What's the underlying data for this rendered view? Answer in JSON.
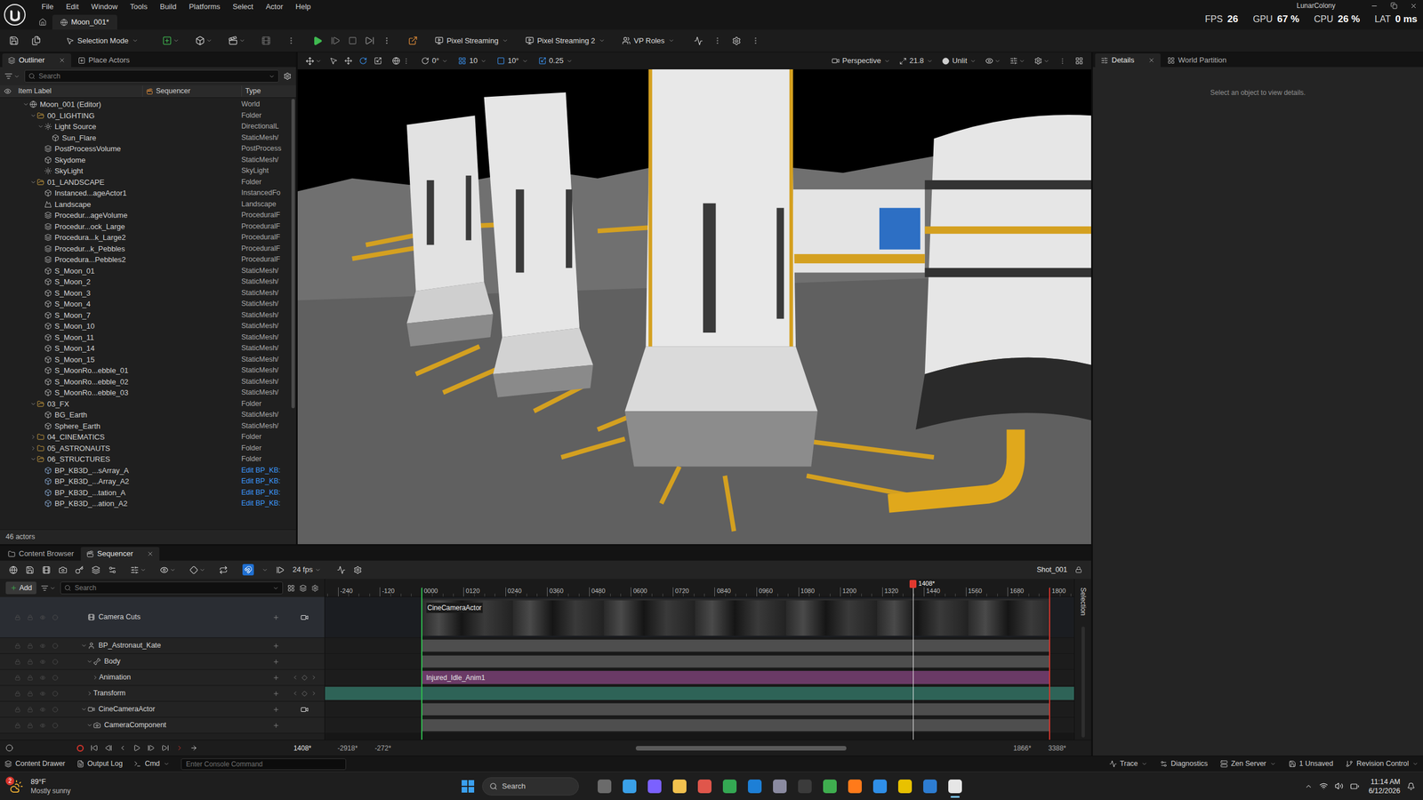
{
  "header": {
    "project": "LunarColony",
    "level_tab": "Moon_001*",
    "menu": [
      "File",
      "Edit",
      "Window",
      "Tools",
      "Build",
      "Platforms",
      "Select",
      "Actor",
      "Help"
    ],
    "stats": [
      {
        "label": "FPS",
        "value": "26"
      },
      {
        "label": "GPU",
        "value": "67 %"
      },
      {
        "label": "CPU",
        "value": "26 %"
      },
      {
        "label": "LAT",
        "value": "0 ms"
      }
    ]
  },
  "toolbar": {
    "mode": "Selection Mode",
    "streaming": [
      "Pixel Streaming",
      "Pixel Streaming 2",
      "VP Roles"
    ]
  },
  "outliner": {
    "tabs": [
      {
        "label": "Outliner",
        "selected": true,
        "closable": true
      },
      {
        "label": "Place Actors",
        "selected": false,
        "closable": false
      }
    ],
    "search_placeholder": "Search",
    "columns": [
      "Item Label",
      "Sequencer",
      "Type"
    ],
    "footer": "46 actors",
    "rows": [
      {
        "label": "Moon_001 (Editor)",
        "type": "World",
        "depth": 0,
        "kind": "world",
        "has_children": true,
        "expanded": true,
        "type_link": false
      },
      {
        "label": "00_LIGHTING",
        "type": "Folder",
        "depth": 1,
        "kind": "folder",
        "has_children": true,
        "expanded": true,
        "type_link": false
      },
      {
        "label": "Light Source",
        "type": "DirectionalL",
        "depth": 2,
        "kind": "light",
        "has_children": true,
        "expanded": true,
        "type_link": false
      },
      {
        "label": "Sun_Flare",
        "type": "StaticMesh/",
        "depth": 3,
        "kind": "mesh",
        "has_children": false,
        "expanded": false,
        "type_link": false
      },
      {
        "label": "PostProcessVolume",
        "type": "PostProcess",
        "depth": 2,
        "kind": "volume",
        "has_children": false,
        "expanded": false,
        "type_link": false
      },
      {
        "label": "Skydome",
        "type": "StaticMesh/",
        "depth": 2,
        "kind": "mesh",
        "has_children": false,
        "expanded": false,
        "type_link": false
      },
      {
        "label": "SkyLight",
        "type": "SkyLight",
        "depth": 2,
        "kind": "light",
        "has_children": false,
        "expanded": false,
        "type_link": false
      },
      {
        "label": "01_LANDSCAPE",
        "type": "Folder",
        "depth": 1,
        "kind": "folder",
        "has_children": true,
        "expanded": true,
        "type_link": false
      },
      {
        "label": "Instanced...ageActor1",
        "type": "InstancedFo",
        "depth": 2,
        "kind": "mesh",
        "has_children": false,
        "expanded": false,
        "type_link": false
      },
      {
        "label": "Landscape",
        "type": "Landscape",
        "depth": 2,
        "kind": "landscape",
        "has_children": false,
        "expanded": false,
        "type_link": false
      },
      {
        "label": "Procedur...ageVolume",
        "type": "ProceduralF",
        "depth": 2,
        "kind": "volume",
        "has_children": false,
        "expanded": false,
        "type_link": false
      },
      {
        "label": "Procedur...ock_Large",
        "type": "ProceduralF",
        "depth": 2,
        "kind": "volume",
        "has_children": false,
        "expanded": false,
        "type_link": false
      },
      {
        "label": "Procedura...k_Large2",
        "type": "ProceduralF",
        "depth": 2,
        "kind": "volume",
        "has_children": false,
        "expanded": false,
        "type_link": false
      },
      {
        "label": "Procedur...k_Pebbles",
        "type": "ProceduralF",
        "depth": 2,
        "kind": "volume",
        "has_children": false,
        "expanded": false,
        "type_link": false
      },
      {
        "label": "Procedura...Pebbles2",
        "type": "ProceduralF",
        "depth": 2,
        "kind": "volume",
        "has_children": false,
        "expanded": false,
        "type_link": false
      },
      {
        "label": "S_Moon_01",
        "type": "StaticMesh/",
        "depth": 2,
        "kind": "mesh",
        "has_children": false,
        "expanded": false,
        "type_link": false
      },
      {
        "label": "S_Moon_2",
        "type": "StaticMesh/",
        "depth": 2,
        "kind": "mesh",
        "has_children": false,
        "expanded": false,
        "type_link": false
      },
      {
        "label": "S_Moon_3",
        "type": "StaticMesh/",
        "depth": 2,
        "kind": "mesh",
        "has_children": false,
        "expanded": false,
        "type_link": false
      },
      {
        "label": "S_Moon_4",
        "type": "StaticMesh/",
        "depth": 2,
        "kind": "mesh",
        "has_children": false,
        "expanded": false,
        "type_link": false
      },
      {
        "label": "S_Moon_7",
        "type": "StaticMesh/",
        "depth": 2,
        "kind": "mesh",
        "has_children": false,
        "expanded": false,
        "type_link": false
      },
      {
        "label": "S_Moon_10",
        "type": "StaticMesh/",
        "depth": 2,
        "kind": "mesh",
        "has_children": false,
        "expanded": false,
        "type_link": false
      },
      {
        "label": "S_Moon_11",
        "type": "StaticMesh/",
        "depth": 2,
        "kind": "mesh",
        "has_children": false,
        "expanded": false,
        "type_link": false
      },
      {
        "label": "S_Moon_14",
        "type": "StaticMesh/",
        "depth": 2,
        "kind": "mesh",
        "has_children": false,
        "expanded": false,
        "type_link": false
      },
      {
        "label": "S_Moon_15",
        "type": "StaticMesh/",
        "depth": 2,
        "kind": "mesh",
        "has_children": false,
        "expanded": false,
        "type_link": false
      },
      {
        "label": "S_MoonRo...ebble_01",
        "type": "StaticMesh/",
        "depth": 2,
        "kind": "mesh",
        "has_children": false,
        "expanded": false,
        "type_link": false
      },
      {
        "label": "S_MoonRo...ebble_02",
        "type": "StaticMesh/",
        "depth": 2,
        "kind": "mesh",
        "has_children": false,
        "expanded": false,
        "type_link": false
      },
      {
        "label": "S_MoonRo...ebble_03",
        "type": "StaticMesh/",
        "depth": 2,
        "kind": "mesh",
        "has_children": false,
        "expanded": false,
        "type_link": false
      },
      {
        "label": "03_FX",
        "type": "Folder",
        "depth": 1,
        "kind": "folder",
        "has_children": true,
        "expanded": true,
        "type_link": false
      },
      {
        "label": "BG_Earth",
        "type": "StaticMesh/",
        "depth": 2,
        "kind": "mesh",
        "has_children": false,
        "expanded": false,
        "type_link": false
      },
      {
        "label": "Sphere_Earth",
        "type": "StaticMesh/",
        "depth": 2,
        "kind": "mesh",
        "has_children": false,
        "expanded": false,
        "type_link": false
      },
      {
        "label": "04_CINEMATICS",
        "type": "Folder",
        "depth": 1,
        "kind": "folder",
        "has_children": true,
        "expanded": false,
        "type_link": false
      },
      {
        "label": "05_ASTRONAUTS",
        "type": "Folder",
        "depth": 1,
        "kind": "folder",
        "has_children": true,
        "expanded": false,
        "type_link": false
      },
      {
        "label": "06_STRUCTURES",
        "type": "Folder",
        "depth": 1,
        "kind": "folder",
        "has_children": true,
        "expanded": true,
        "type_link": false
      },
      {
        "label": "BP_KB3D_...sArray_A",
        "type": "Edit BP_KB:",
        "depth": 2,
        "kind": "blueprint",
        "has_children": false,
        "expanded": false,
        "type_link": true
      },
      {
        "label": "BP_KB3D_...Array_A2",
        "type": "Edit BP_KB:",
        "depth": 2,
        "kind": "blueprint",
        "has_children": false,
        "expanded": false,
        "type_link": true
      },
      {
        "label": "BP_KB3D_...tation_A",
        "type": "Edit BP_KB:",
        "depth": 2,
        "kind": "blueprint",
        "has_children": false,
        "expanded": false,
        "type_link": true
      },
      {
        "label": "BP_KB3D_...ation_A2",
        "type": "Edit BP_KB:",
        "depth": 2,
        "kind": "blueprint",
        "has_children": false,
        "expanded": false,
        "type_link": true
      }
    ]
  },
  "viewport": {
    "tools": [
      {
        "kind": "select",
        "selected": false
      },
      {
        "kind": "move",
        "selected": false
      },
      {
        "kind": "rotate",
        "selected": true
      },
      {
        "kind": "scale",
        "selected": false
      }
    ],
    "snaps": [
      {
        "value": "0°",
        "active": false
      },
      {
        "value": "10",
        "active": true
      },
      {
        "value": "10°",
        "active": true
      },
      {
        "value": "0.25",
        "active": true
      }
    ],
    "perspective": "Perspective",
    "fov": "21.8",
    "lighting": "Unlit"
  },
  "details": {
    "tabs": [
      {
        "label": "Details",
        "selected": true,
        "closable": true
      },
      {
        "label": "World Partition",
        "selected": false,
        "closable": false
      }
    ],
    "empty_message": "Select an object to view details."
  },
  "sequencer": {
    "tabs": [
      {
        "label": "Content Browser",
        "selected": false,
        "closable": false
      },
      {
        "label": "Sequencer",
        "selected": true,
        "closable": true
      }
    ],
    "fps": "24 fps",
    "shot": "Shot_001",
    "snap_enabled": true,
    "add_label": "Add",
    "search_placeholder": "Search",
    "ticks": [
      "-240",
      "-120",
      "0000",
      "0120",
      "0240",
      "0360",
      "0480",
      "0600",
      "0720",
      "0840",
      "0960",
      "1080",
      "1200",
      "1320",
      "1440",
      "1560",
      "1680",
      "1800"
    ],
    "range_start": 0,
    "range_end": 1800,
    "playhead": "1408*",
    "side_label": "Selection",
    "tracks": [
      {
        "label": "Camera Cuts",
        "depth": 0,
        "kind": "camera-cuts",
        "has_children": false,
        "expanded": false,
        "lane": "thumbnails",
        "clip_label": "CineCameraActor",
        "color": "#2b2b2b"
      },
      {
        "label": "BP_Astronaut_Kate",
        "depth": 0,
        "kind": "actor",
        "has_children": true,
        "expanded": true,
        "lane": "range",
        "color": "#4e4e4e"
      },
      {
        "label": "Body",
        "depth": 1,
        "kind": "component",
        "has_children": true,
        "expanded": true,
        "lane": "range",
        "color": "#4e4e4e"
      },
      {
        "label": "Animation",
        "depth": 2,
        "kind": "animation",
        "has_children": true,
        "expanded": false,
        "lane": "clip",
        "clip_label": "Injured_Idle_Anim1",
        "color": "#6a3a66"
      },
      {
        "label": "Transform",
        "depth": 1,
        "kind": "transform",
        "has_children": true,
        "expanded": false,
        "lane": "full",
        "color": "#2e6357"
      },
      {
        "label": "CineCameraActor",
        "depth": 0,
        "kind": "camera",
        "has_children": true,
        "expanded": true,
        "lane": "range",
        "color": "#4e4e4e"
      },
      {
        "label": "CameraComponent",
        "depth": 1,
        "kind": "camera-component",
        "has_children": true,
        "expanded": true,
        "lane": "range",
        "color": "#4e4e4e"
      }
    ],
    "transport": {
      "current": "1408*",
      "view_in": "-2918*",
      "work_in": "-272*",
      "work_out": "1866*",
      "view_out": "3388*"
    }
  },
  "status_bar": {
    "left": [
      "Content Drawer",
      "Output Log",
      "Cmd"
    ],
    "console_placeholder": "Enter Console Command",
    "right": [
      "Trace",
      "Diagnostics",
      "Zen Server",
      "1 Unsaved",
      "Revision Control"
    ]
  },
  "taskbar": {
    "weather": {
      "temp": "89°F",
      "desc": "Mostly sunny",
      "badge": "2"
    },
    "search": "Search",
    "time": "11:14 AM",
    "date": "6/12/2026",
    "apps": [
      {
        "color": "#6b6b6b",
        "active": false
      },
      {
        "color": "#3aa0e8",
        "active": false
      },
      {
        "color": "#7b61ff",
        "active": false
      },
      {
        "color": "#f2c14e",
        "active": false
      },
      {
        "color": "#e0564b",
        "active": false
      },
      {
        "color": "#34a853",
        "active": false
      },
      {
        "color": "#1d7fd6",
        "active": false
      },
      {
        "color": "#8a8aa0",
        "active": false
      },
      {
        "color": "#3b3b3b",
        "active": false
      },
      {
        "color": "#3fae4f",
        "active": false
      },
      {
        "color": "#ff7a1a",
        "active": false
      },
      {
        "color": "#2f8fe8",
        "active": false
      },
      {
        "color": "#e8c100",
        "active": false
      },
      {
        "color": "#2d7dd2",
        "active": false
      },
      {
        "color": "#e6e6e6",
        "active": true
      }
    ]
  }
}
